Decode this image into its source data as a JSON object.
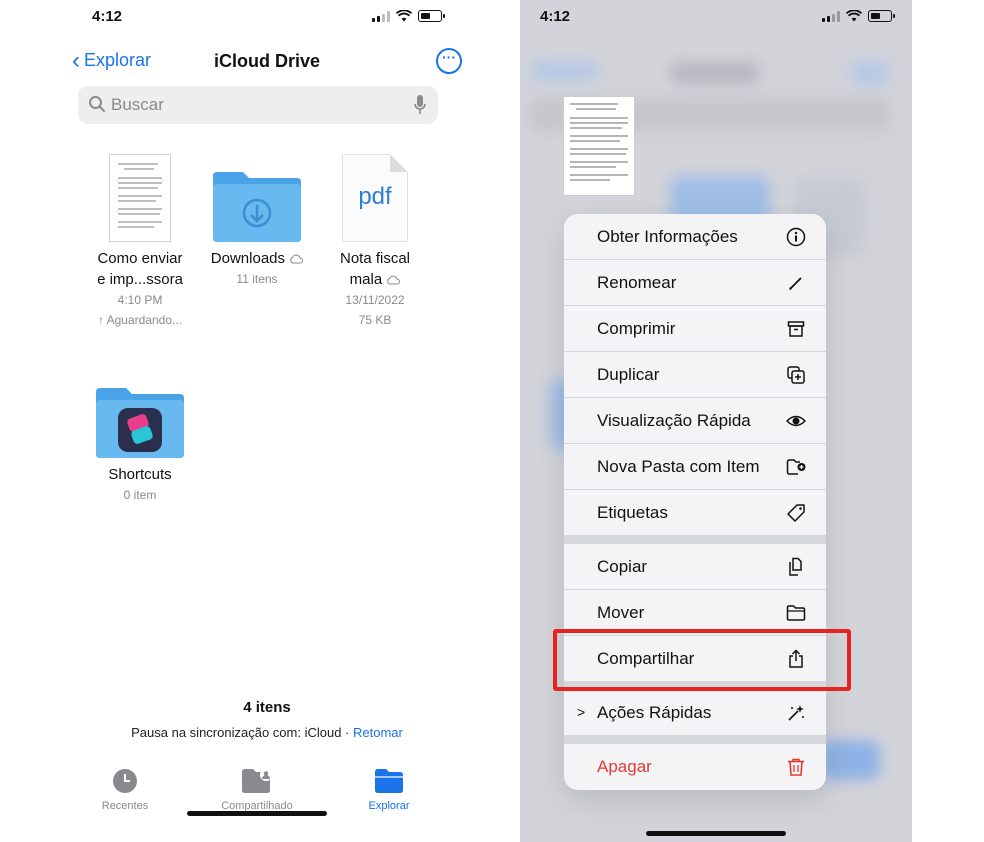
{
  "left": {
    "status": {
      "time": "4:12"
    },
    "nav": {
      "back_label": "Explorar",
      "title": "iCloud Drive"
    },
    "search": {
      "placeholder": "Buscar"
    },
    "files": [
      {
        "name_line1": "Como enviar",
        "name_line2": "e imp...ssora",
        "meta1": "4:10 PM",
        "meta2": "↑ Aguardando..."
      },
      {
        "name_line1": "Downloads",
        "meta1": "11 itens"
      },
      {
        "name_line1": "Nota fiscal",
        "name_line2": "mala",
        "meta1": "13/11/2022",
        "meta2": "75 KB",
        "thumb_label": "pdf"
      },
      {
        "name_line1": "Shortcuts",
        "meta1": "0 item"
      }
    ],
    "footer": {
      "count": "4 itens",
      "sync_text": "Pausa na sincronização com: iCloud",
      "sync_sep": " · ",
      "resume": "Retomar"
    },
    "tabs": [
      {
        "label": "Recentes"
      },
      {
        "label": "Compartilhado"
      },
      {
        "label": "Explorar"
      }
    ]
  },
  "right": {
    "status": {
      "time": "4:12"
    },
    "menu": {
      "items": [
        {
          "label": "Obter Informações",
          "icon": "info-icon"
        },
        {
          "label": "Renomear",
          "icon": "pencil-icon"
        },
        {
          "label": "Comprimir",
          "icon": "archive-box-icon"
        },
        {
          "label": "Duplicar",
          "icon": "duplicate-icon"
        },
        {
          "label": "Visualização Rápida",
          "icon": "eye-icon"
        },
        {
          "label": "Nova Pasta com Item",
          "icon": "folder-badge-plus-icon"
        },
        {
          "label": "Etiquetas",
          "icon": "tag-icon"
        }
      ],
      "items2": [
        {
          "label": "Copiar",
          "icon": "copy-docs-icon"
        },
        {
          "label": "Mover",
          "icon": "folder-icon"
        },
        {
          "label": "Compartilhar",
          "icon": "share-icon"
        }
      ],
      "quick_actions": {
        "label": "Ações Rápidas",
        "icon": "sparkles-icon"
      },
      "delete": {
        "label": "Apagar",
        "icon": "trash-icon"
      }
    }
  },
  "colors": {
    "accent": "#1a73e8",
    "danger": "#e33a32",
    "highlight": "#e52422",
    "folder": "#5fb4ef"
  }
}
